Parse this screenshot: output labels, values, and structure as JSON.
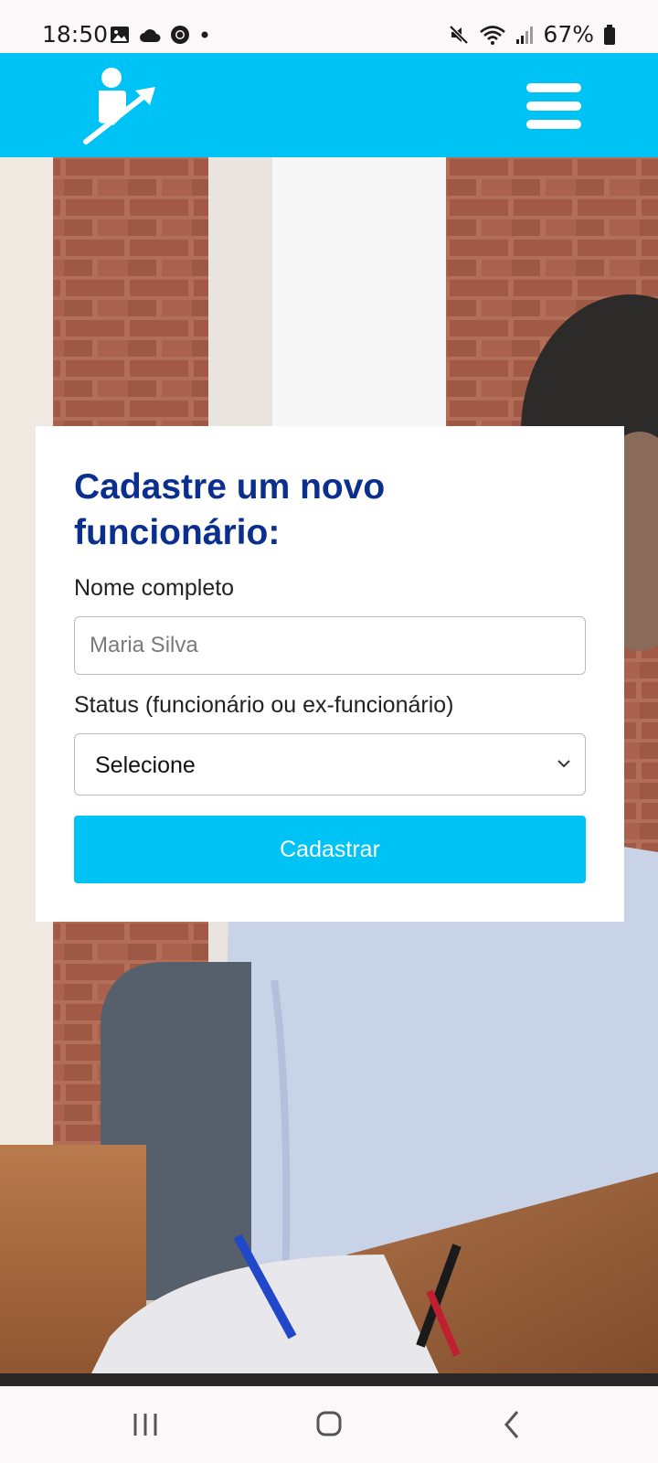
{
  "status_bar": {
    "time": "18:50",
    "battery": "67%"
  },
  "header": {
    "logo_icon": "person-growth-arrow-icon",
    "menu_icon": "hamburger-menu-icon",
    "background_color": "#00c3f5"
  },
  "form": {
    "title": "Cadastre um novo funcionário:",
    "name_label": "Nome completo",
    "name_placeholder": "Maria Silva",
    "name_value": "",
    "status_label": "Status (funcionário ou ex-funcionário)",
    "status_selected": "Selecione",
    "submit_label": "Cadastrar",
    "title_color": "#0b2f8e",
    "button_color": "#00c3f5"
  },
  "nav_bar": {
    "recent_icon": "recent-apps-icon",
    "home_icon": "home-icon",
    "back_icon": "back-icon"
  }
}
